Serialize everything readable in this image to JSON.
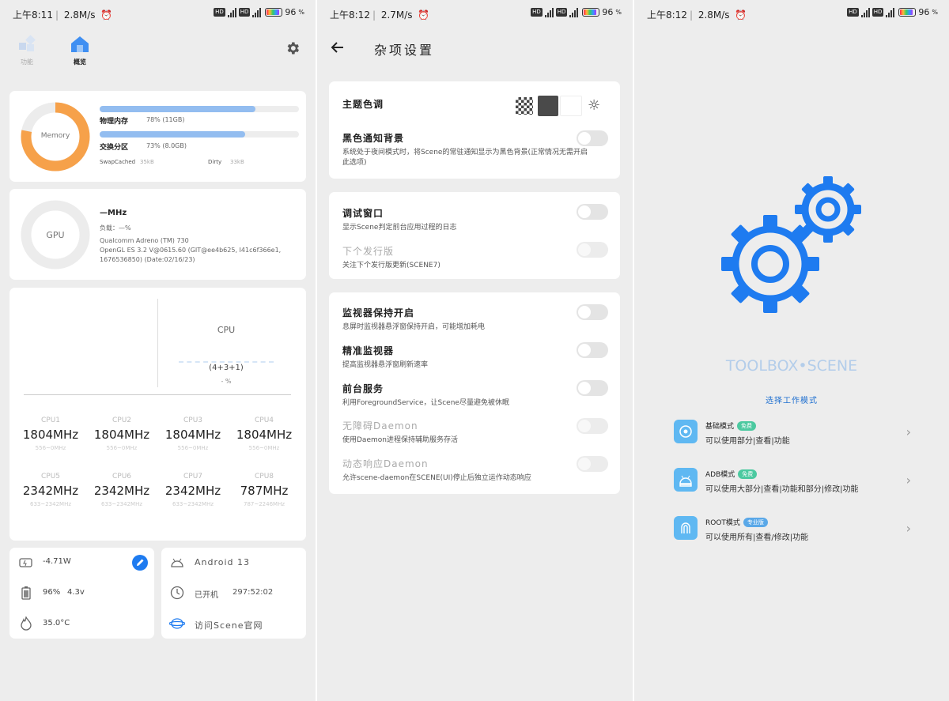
{
  "status": [
    {
      "time": "上午8:11",
      "speed": "2.8M/s",
      "battery": "96"
    },
    {
      "time": "上午8:12",
      "speed": "2.7M/s",
      "battery": "96"
    },
    {
      "time": "上午8:12",
      "speed": "2.8M/s",
      "battery": "96"
    }
  ],
  "status_icons": {
    "hd": "HD",
    "net": "5G",
    "pct": "%"
  },
  "overview": {
    "nav": {
      "func_label": "功能",
      "overview_label": "概览"
    },
    "memory": {
      "ring_label": "Memory",
      "ring_percent": 78,
      "physical_label": "物理内存",
      "physical_value": "78% (11GB)",
      "physical_fill": 78,
      "swap_label": "交换分区",
      "swap_value": "73% (8.0GB)",
      "swap_fill": 73,
      "swapcached_label": "SwapCached",
      "swapcached_value": "35kB",
      "dirty_label": "Dirty",
      "dirty_value": "33kB"
    },
    "gpu": {
      "ring_label": "GPU",
      "freq": "—MHz",
      "load": "负载：—%",
      "model": "Qualcomm Adreno (TM) 730",
      "opengl": "OpenGL ES 3.2 V@0615.60 (GIT@ee4b625, I41c6f366e1, 1676536850) (Date:02/16/23)"
    },
    "cpu": {
      "title": "CPU",
      "cores": "(4+3+1)",
      "usage": "- %",
      "cells": [
        {
          "name": "CPU1",
          "freq": "1804MHz",
          "range": "556~0MHz"
        },
        {
          "name": "CPU2",
          "freq": "1804MHz",
          "range": "556~0MHz"
        },
        {
          "name": "CPU3",
          "freq": "1804MHz",
          "range": "556~0MHz"
        },
        {
          "name": "CPU4",
          "freq": "1804MHz",
          "range": "556~0MHz"
        },
        {
          "name": "CPU5",
          "freq": "2342MHz",
          "range": "633~2342MHz"
        },
        {
          "name": "CPU6",
          "freq": "2342MHz",
          "range": "633~2342MHz"
        },
        {
          "name": "CPU7",
          "freq": "2342MHz",
          "range": "633~2342MHz"
        },
        {
          "name": "CPU8",
          "freq": "787MHz",
          "range": "787~2246MHz"
        }
      ]
    },
    "battery": {
      "power": "-4.71W",
      "level": "96%",
      "voltage": "4.3v",
      "temp": "35.0°C"
    },
    "system": {
      "android": "Android 13",
      "uptime_label": "已开机",
      "uptime": "297:52:02",
      "website": "访问Scene官网"
    }
  },
  "settings": {
    "title": "杂项设置",
    "theme_label": "主题色调",
    "rows": [
      {
        "title": "黑色通知背景",
        "desc": "系统处于夜间模式时，将Scene的常驻通知显示为黑色背景(正常情况无需开启此选项)",
        "disabled": false
      },
      {
        "title": "调试窗口",
        "desc": "显示Scene判定前台应用过程的日志",
        "disabled": false
      },
      {
        "title": "下个发行版",
        "desc": "关注下个发行版更新(SCENE7)",
        "disabled": true
      },
      {
        "title": "监视器保持开启",
        "desc": "息屏时监视器悬浮窗保持开启，可能增加耗电",
        "disabled": false
      },
      {
        "title": "精准监视器",
        "desc": "提高监视器悬浮窗刷新速率",
        "disabled": false
      },
      {
        "title": "前台服务",
        "desc": "利用ForegroundService，让Scene尽量避免被休眠",
        "disabled": false
      },
      {
        "title": "无障碍Daemon",
        "desc": "使用Daemon进程保持辅助服务存活",
        "disabled": true
      },
      {
        "title": "动态响应Daemon",
        "desc": "允许scene-daemon在SCENE(UI)停止后独立运作动态响应",
        "disabled": true
      }
    ]
  },
  "launcher": {
    "brand": "TOOLBOX•SCENE",
    "choose": "选择工作模式",
    "modes": [
      {
        "name": "基础模式",
        "badge": "免费",
        "badge_color": "#4cc9a0",
        "desc": "可以使用部分|查看|功能"
      },
      {
        "name": "ADB模式",
        "badge": "免费",
        "badge_color": "#4cc9a0",
        "desc": "可以使用大部分|查看|功能和部分|修改|功能"
      },
      {
        "name": "ROOT模式",
        "badge": "专业版",
        "badge_color": "#5aa8e8",
        "desc": "可以使用所有|查看/修改|功能"
      }
    ]
  },
  "colors": {
    "accent": "#1e7bf0",
    "ring_memory": "#f6a14a",
    "bar": "#93bdf0",
    "gear": "#1e7bf0"
  }
}
